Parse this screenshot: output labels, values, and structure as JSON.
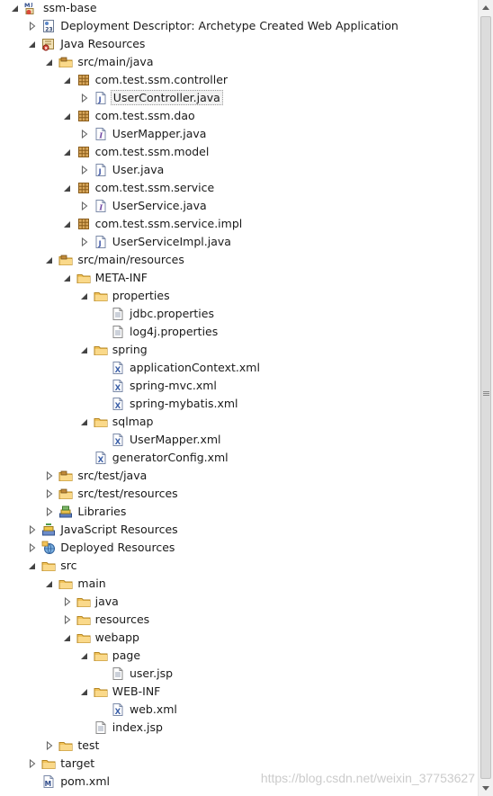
{
  "tree": [
    {
      "level": 0,
      "expanded": true,
      "icon": "maven-web-project-icon",
      "label": "ssm-base"
    },
    {
      "level": 1,
      "expanded": false,
      "icon": "deployment-descriptor-icon",
      "label": "Deployment Descriptor: Archetype Created Web Application"
    },
    {
      "level": 1,
      "expanded": true,
      "icon": "java-resources-icon",
      "label": "Java Resources"
    },
    {
      "level": 2,
      "expanded": true,
      "icon": "source-folder-icon",
      "label": "src/main/java"
    },
    {
      "level": 3,
      "expanded": true,
      "icon": "package-icon",
      "label": "com.test.ssm.controller"
    },
    {
      "level": 4,
      "expanded": false,
      "icon": "java-file-icon",
      "label": "UserController.java",
      "selected": true
    },
    {
      "level": 3,
      "expanded": true,
      "icon": "package-icon",
      "label": "com.test.ssm.dao"
    },
    {
      "level": 4,
      "expanded": false,
      "icon": "java-interface-file-icon",
      "label": "UserMapper.java"
    },
    {
      "level": 3,
      "expanded": true,
      "icon": "package-icon",
      "label": "com.test.ssm.model"
    },
    {
      "level": 4,
      "expanded": false,
      "icon": "java-file-icon",
      "label": "User.java"
    },
    {
      "level": 3,
      "expanded": true,
      "icon": "package-icon",
      "label": "com.test.ssm.service"
    },
    {
      "level": 4,
      "expanded": false,
      "icon": "java-interface-file-icon",
      "label": "UserService.java"
    },
    {
      "level": 3,
      "expanded": true,
      "icon": "package-icon",
      "label": "com.test.ssm.service.impl"
    },
    {
      "level": 4,
      "expanded": false,
      "icon": "java-file-icon",
      "label": "UserServiceImpl.java"
    },
    {
      "level": 2,
      "expanded": true,
      "icon": "source-folder-icon",
      "label": "src/main/resources"
    },
    {
      "level": 3,
      "expanded": true,
      "icon": "folder-icon",
      "label": "META-INF"
    },
    {
      "level": 4,
      "expanded": true,
      "icon": "folder-icon",
      "label": "properties"
    },
    {
      "level": 5,
      "icon": "text-file-icon",
      "label": "jdbc.properties"
    },
    {
      "level": 5,
      "icon": "text-file-icon",
      "label": "log4j.properties"
    },
    {
      "level": 4,
      "expanded": true,
      "icon": "folder-icon",
      "label": "spring"
    },
    {
      "level": 5,
      "icon": "xml-file-icon",
      "label": "applicationContext.xml"
    },
    {
      "level": 5,
      "icon": "xml-file-icon",
      "label": "spring-mvc.xml"
    },
    {
      "level": 5,
      "icon": "xml-file-icon",
      "label": "spring-mybatis.xml"
    },
    {
      "level": 4,
      "expanded": true,
      "icon": "folder-icon",
      "label": "sqlmap"
    },
    {
      "level": 5,
      "icon": "xml-file-icon",
      "label": "UserMapper.xml"
    },
    {
      "level": 4,
      "icon": "xml-file-icon",
      "label": "generatorConfig.xml"
    },
    {
      "level": 2,
      "expanded": false,
      "icon": "source-folder-icon",
      "label": "src/test/java"
    },
    {
      "level": 2,
      "expanded": false,
      "icon": "source-folder-icon",
      "label": "src/test/resources"
    },
    {
      "level": 2,
      "expanded": false,
      "icon": "libraries-icon",
      "label": "Libraries"
    },
    {
      "level": 1,
      "expanded": false,
      "icon": "javascript-resources-icon",
      "label": "JavaScript Resources"
    },
    {
      "level": 1,
      "expanded": false,
      "icon": "deployed-resources-icon",
      "label": "Deployed Resources"
    },
    {
      "level": 1,
      "expanded": true,
      "icon": "folder-icon",
      "label": "src"
    },
    {
      "level": 2,
      "expanded": true,
      "icon": "folder-icon",
      "label": "main"
    },
    {
      "level": 3,
      "expanded": false,
      "icon": "folder-icon",
      "label": "java"
    },
    {
      "level": 3,
      "expanded": false,
      "icon": "folder-icon",
      "label": "resources"
    },
    {
      "level": 3,
      "expanded": true,
      "icon": "folder-icon",
      "label": "webapp"
    },
    {
      "level": 4,
      "expanded": true,
      "icon": "folder-icon",
      "label": "page"
    },
    {
      "level": 5,
      "icon": "text-file-icon",
      "label": "user.jsp"
    },
    {
      "level": 4,
      "expanded": true,
      "icon": "folder-icon",
      "label": "WEB-INF"
    },
    {
      "level": 5,
      "icon": "xml-file-icon",
      "label": "web.xml"
    },
    {
      "level": 4,
      "icon": "text-file-icon",
      "label": "index.jsp"
    },
    {
      "level": 2,
      "expanded": false,
      "icon": "folder-icon",
      "label": "test"
    },
    {
      "level": 1,
      "expanded": false,
      "icon": "folder-icon",
      "label": "target"
    },
    {
      "level": 1,
      "icon": "maven-pom-icon",
      "label": "pom.xml"
    }
  ],
  "watermark": "https://blog.csdn.net/weixin_37753627"
}
